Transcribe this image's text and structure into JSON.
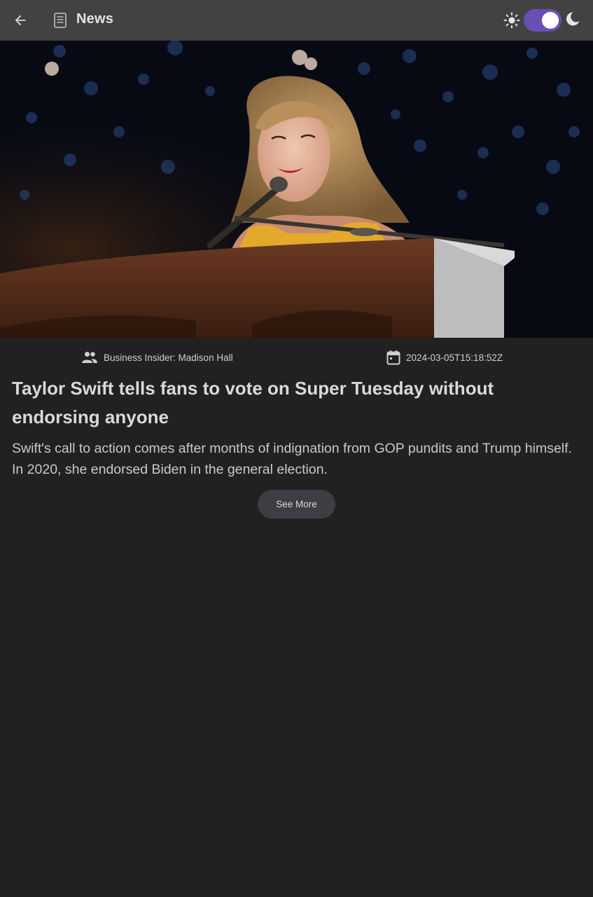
{
  "appbar": {
    "title": "News",
    "back_icon": "arrow-back-icon",
    "title_icon": "newspaper-icon",
    "theme_toggle": {
      "light_icon": "sun-icon",
      "dark_icon": "moon-icon",
      "state": "on"
    }
  },
  "article": {
    "image_alt": "Singer at a piano singing into a microphone on a concert stage",
    "source_icon": "people-icon",
    "source": "Business Insider: Madison Hall",
    "date_icon": "calendar-icon",
    "published_at": "2024-03-05T15:18:52Z",
    "title": "Taylor Swift tells fans to vote on Super Tuesday without endorsing anyone",
    "description": "Swift's call to action comes after months of indignation from GOP pundits and Trump himself. In 2020, she endorsed Biden in the general election.",
    "see_more_label": "See More"
  },
  "colors": {
    "background": "#212121",
    "appbar": "#424242",
    "toggle_accent": "#6a4fb3",
    "button": "#3f3d44"
  }
}
